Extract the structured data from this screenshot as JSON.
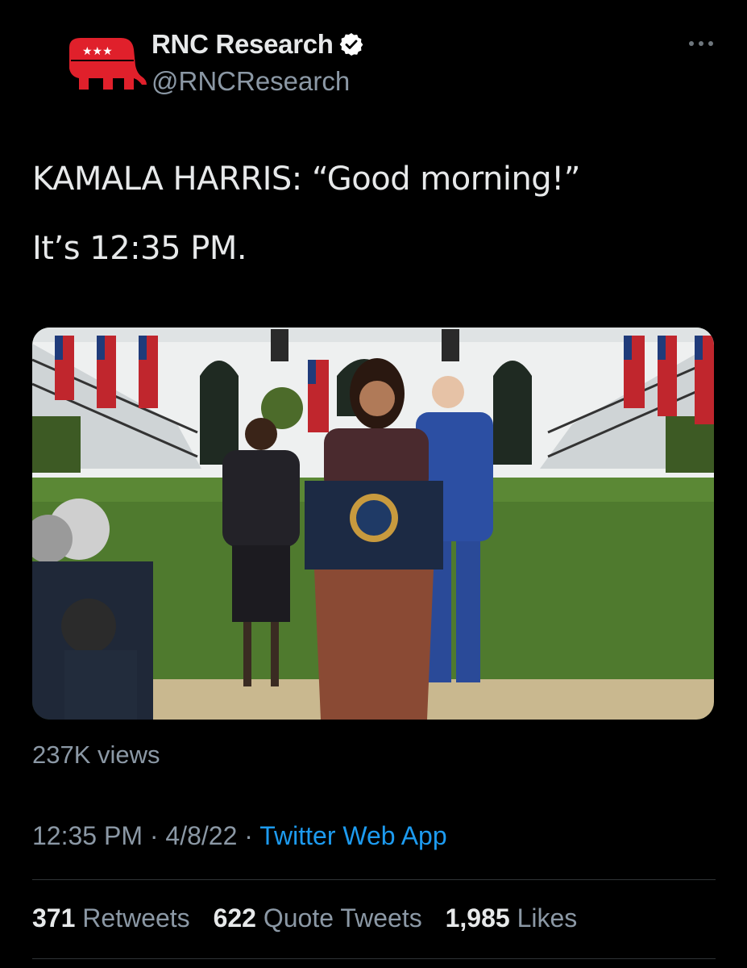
{
  "author": {
    "display_name": "RNC Research",
    "handle": "@RNCResearch",
    "avatar_icon": "gop-elephant-icon",
    "verified_icon": "verified-badge-icon"
  },
  "tweet": {
    "line1": "KAMALA HARRIS: “Good morning!”",
    "line2": "It’s 12:35 PM."
  },
  "media": {
    "type": "video"
  },
  "views": "237K views",
  "meta": {
    "time": "12:35 PM",
    "separator": " · ",
    "date": "4/8/22",
    "source": "Twitter Web App"
  },
  "stats": {
    "retweets_count": "371",
    "retweets_label": "Retweets",
    "quotes_count": "622",
    "quotes_label": "Quote Tweets",
    "likes_count": "1,985",
    "likes_label": "Likes"
  },
  "colors": {
    "background": "#000000",
    "link": "#1d9bf0",
    "secondary_text": "#8b98a5",
    "primary_text": "#e7e9ea",
    "verified_badge": "#ffffff",
    "rnc_red": "#e0202b"
  }
}
